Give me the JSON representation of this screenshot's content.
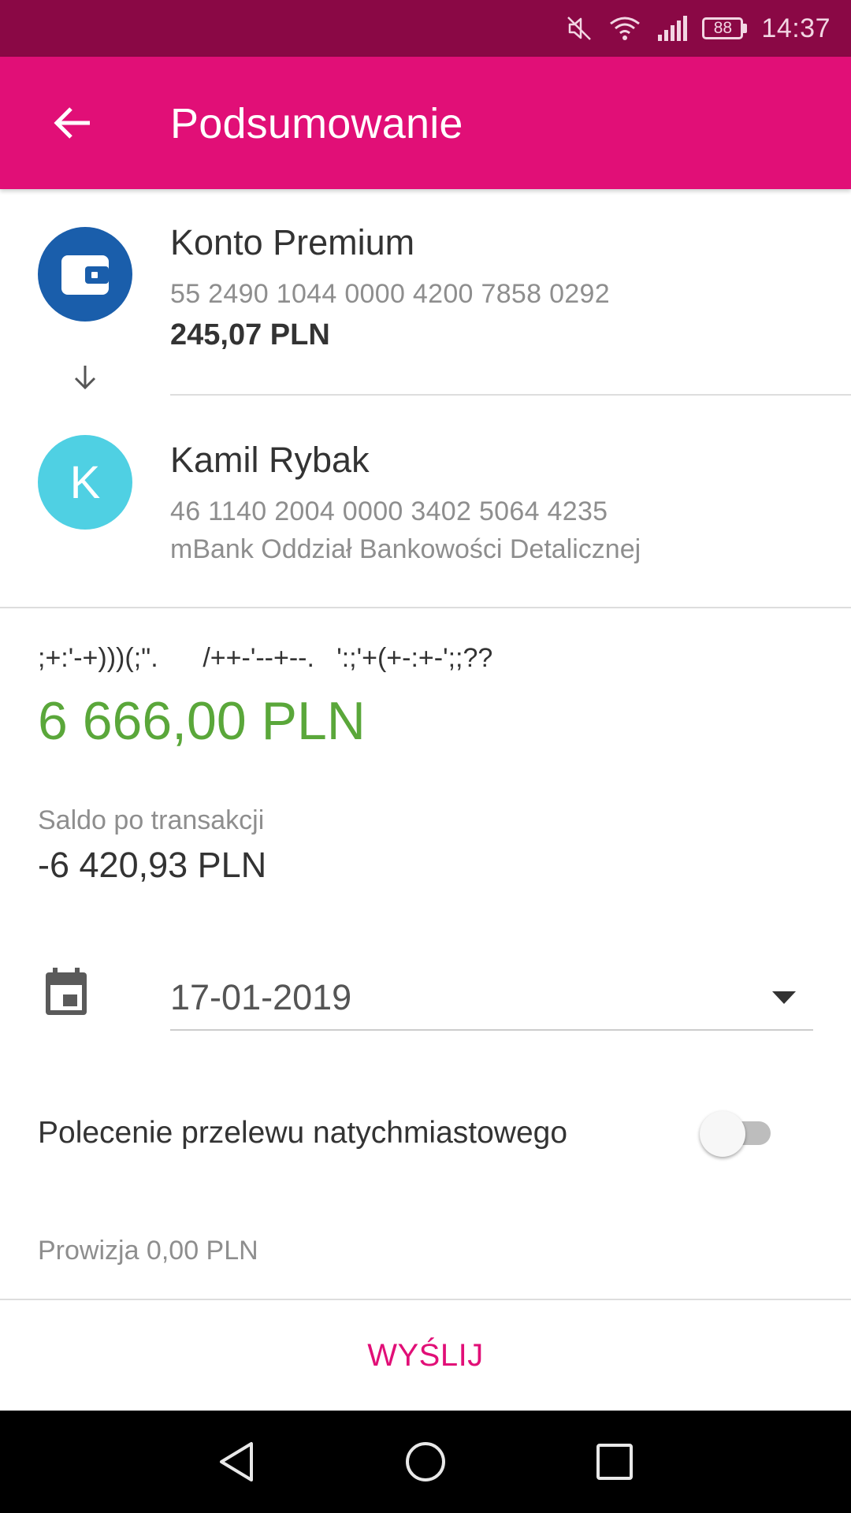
{
  "status_bar": {
    "battery": "88",
    "time": "14:37"
  },
  "app_bar": {
    "title": "Podsumowanie"
  },
  "source_account": {
    "name": "Konto Premium",
    "number": "55 2490 1044 0000 4200 7858 0292",
    "balance": "245,07 PLN",
    "avatar_color": "#1a5eab"
  },
  "recipient": {
    "initial": "K",
    "name": "Kamil Rybak",
    "number": "46 1140 2004 0000 3402 5064 4235",
    "bank": "mBank Oddział Bankowości Detalicznej",
    "avatar_color": "#4fd0e3"
  },
  "transfer": {
    "title": ";+:'-+)))(;\".      /++-'--+--.   ':;'+(+-:+-';;??",
    "amount": "6 666,00 PLN",
    "balance_after_label": "Saldo po transakcji",
    "balance_after": "-6 420,93 PLN",
    "date": "17-01-2019",
    "instant_label": "Polecenie przelewu natychmiastowego",
    "instant_enabled": false,
    "fee": "Prowizja 0,00 PLN"
  },
  "actions": {
    "send_label": "WYŚLIJ"
  },
  "colors": {
    "status_bar": "#8a0845",
    "app_bar": "#e10f77",
    "amount": "#5aa73a",
    "accent": "#e10f77"
  },
  "icons": {
    "back": "arrow-left-icon",
    "wallet": "wallet-icon",
    "transfer_direction": "arrow-down-icon",
    "calendar": "calendar-icon",
    "dropdown": "triangle-down-icon",
    "nav_back": "nav-back-icon",
    "nav_home": "nav-home-icon",
    "nav_recent": "nav-recent-icon"
  }
}
